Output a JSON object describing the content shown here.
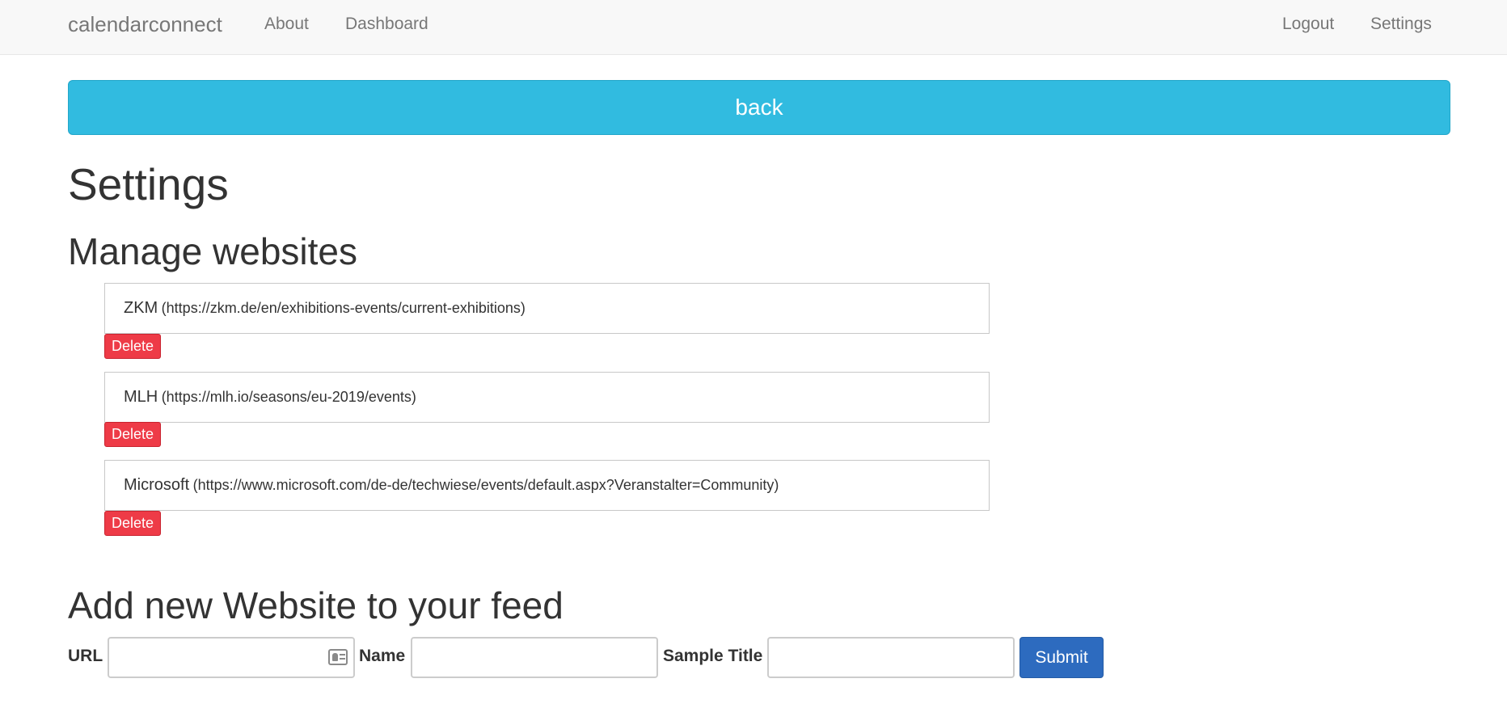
{
  "navbar": {
    "brand": "calendarconnect",
    "left_links": [
      "About",
      "Dashboard"
    ],
    "right_links": [
      "Logout",
      "Settings"
    ]
  },
  "back_button": "back",
  "page_title": "Settings",
  "manage_section": {
    "title": "Manage websites",
    "websites": [
      {
        "name": "ZKM",
        "url": "(https://zkm.de/en/exhibitions-events/current-exhibitions)",
        "delete_label": "Delete"
      },
      {
        "name": "MLH",
        "url": "(https://mlh.io/seasons/eu-2019/events)",
        "delete_label": "Delete"
      },
      {
        "name": "Microsoft",
        "url": "(https://www.microsoft.com/de-de/techwiese/events/default.aspx?Veranstalter=Community)",
        "delete_label": "Delete"
      }
    ]
  },
  "add_section": {
    "title": "Add new Website to your feed",
    "url_label": "URL",
    "url_value": "",
    "name_label": "Name",
    "name_value": "",
    "sample_title_label": "Sample Title",
    "sample_title_value": "",
    "submit_label": "Submit",
    "url_field_icon": "contact-card-icon"
  },
  "colors": {
    "navbar_bg": "#f8f8f8",
    "back_button": "#31bbe0",
    "delete_button": "#ee3b47",
    "submit_button": "#2d6bbf",
    "text": "#333333",
    "nav_text": "#777777"
  }
}
